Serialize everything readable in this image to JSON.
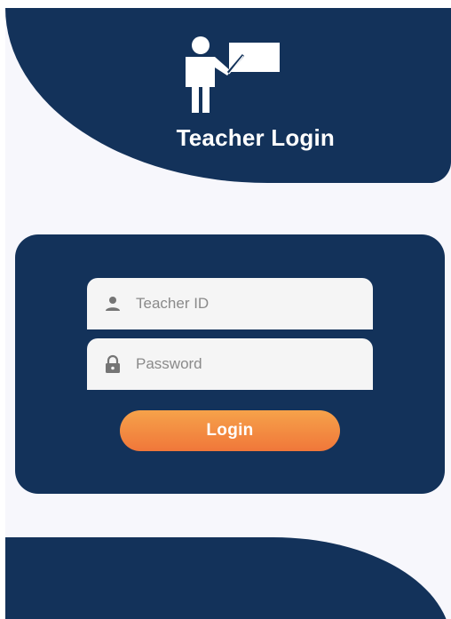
{
  "header": {
    "title": "Teacher Login",
    "icon": "teacher-at-board-icon"
  },
  "form": {
    "teacher_id": {
      "placeholder": "Teacher ID",
      "value": "",
      "icon": "person-icon"
    },
    "password": {
      "placeholder": "Password",
      "value": "",
      "icon": "lock-icon"
    },
    "login_label": "Login"
  },
  "colors": {
    "navy": "#13325a",
    "background": "#f7f7fc",
    "field": "#f5f5f5",
    "button_top": "#f6a24a",
    "button_bottom": "#f0773a",
    "icon_gray": "#757575"
  }
}
